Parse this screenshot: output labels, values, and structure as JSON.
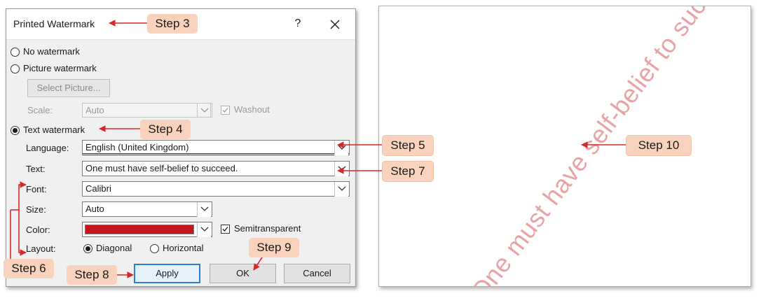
{
  "dialog": {
    "title": "Printed Watermark",
    "help_label": "?",
    "no_watermark": "No watermark",
    "picture_watermark": "Picture watermark",
    "select_picture": "Select Picture...",
    "scale_label": "Scale:",
    "scale_value": "Auto",
    "washout_label": "Washout",
    "text_watermark": "Text watermark",
    "language_label": "Language:",
    "language_value": "English (United Kingdom)",
    "text_label": "Text:",
    "text_value": "One must have self-belief to succeed.",
    "font_label": "Font:",
    "font_value": "Calibri",
    "size_label": "Size:",
    "size_value": "Auto",
    "color_label": "Color:",
    "color_value": "#c4161c",
    "semitransparent_label": "Semitransparent",
    "layout_label": "Layout:",
    "diagonal_label": "Diagonal",
    "horizontal_label": "Horizontal",
    "apply_label": "Apply",
    "ok_label": "OK",
    "cancel_label": "Cancel",
    "selected_option": "text_watermark",
    "selected_layout": "diagonal",
    "semitransparent_checked": true,
    "washout_checked": true
  },
  "preview": {
    "watermark_text": "One must have self-belief to succeed.",
    "watermark_color": "#e7a3a5"
  },
  "steps": {
    "step3": "Step 3",
    "step4": "Step 4",
    "step5": "Step 5",
    "step6": "Step 6",
    "step7": "Step 7",
    "step8": "Step 8",
    "step9": "Step 9",
    "step10": "Step 10"
  },
  "colors": {
    "arrow": "#d62828",
    "callout_bg": "#f8d2bd"
  }
}
